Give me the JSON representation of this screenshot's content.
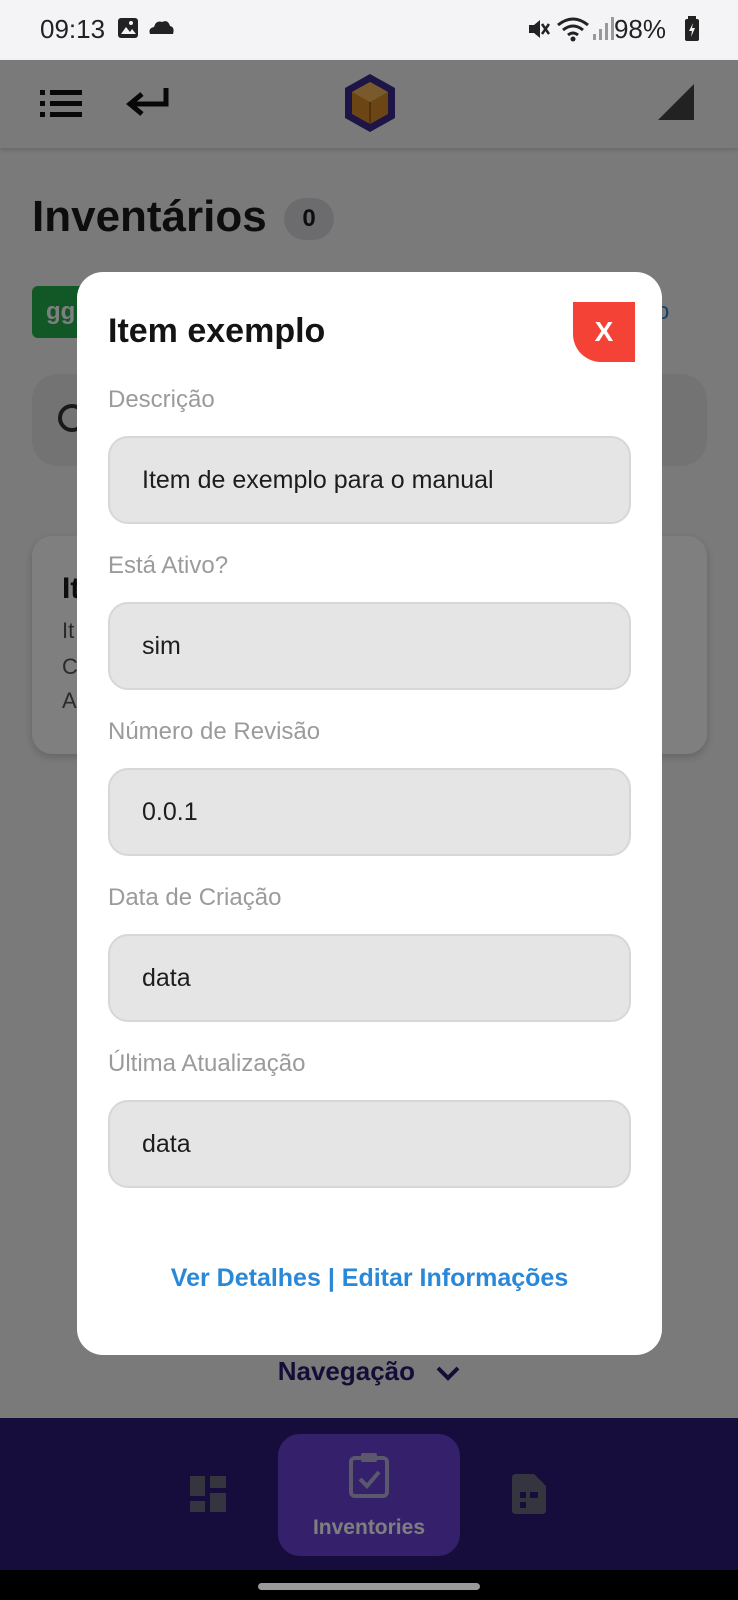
{
  "status_bar": {
    "time": "09:13",
    "battery": "98%"
  },
  "page": {
    "title": "Inventários",
    "count": "0",
    "tag": "gg",
    "link_peek": "o"
  },
  "card": {
    "title": "It",
    "line1": "It",
    "line2": "C",
    "line3": "A"
  },
  "dialog": {
    "title": "Item exemplo",
    "close_label": "X",
    "fields": [
      {
        "label": "Descrição",
        "value": "Item de exemplo para o manual"
      },
      {
        "label": "Está Ativo?",
        "value": "sim"
      },
      {
        "label": "Número de Revisão",
        "value": "0.0.1"
      },
      {
        "label": "Data de Criação",
        "value": "data"
      },
      {
        "label": "Última Atualização",
        "value": "data"
      }
    ],
    "link_details": "Ver Detalhes",
    "link_separator": " | ",
    "link_edit": "Editar Informações"
  },
  "navigation": {
    "toggle_label": "Navegação",
    "active_tab_label": "Inventories"
  },
  "colors": {
    "close": "#f44336",
    "link": "#2a88d8",
    "nav_bar": "#2d1a7a",
    "nav_active": "#6a42d6",
    "tag": "#22b14c"
  },
  "icons": [
    "menu-list-icon",
    "back-arrow-icon",
    "app-logo-box-icon",
    "signal-corner-icon",
    "search-icon",
    "chevron-down-icon",
    "dashboard-icon",
    "clipboard-check-icon",
    "document-icon",
    "image-icon",
    "cloud-icon",
    "mute-icon",
    "wifi-icon",
    "cell-signal-icon",
    "battery-icon"
  ]
}
